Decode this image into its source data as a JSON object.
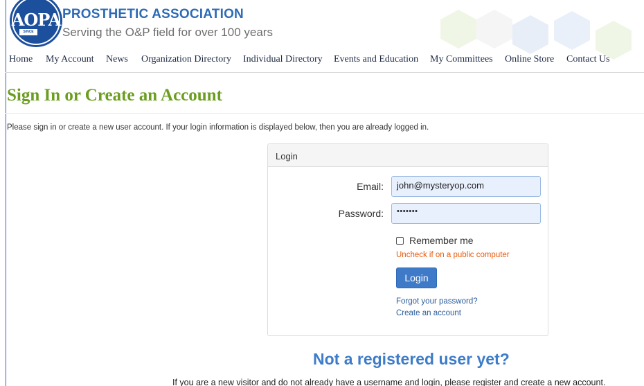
{
  "header": {
    "org_name": "PROSTHETIC ASSOCIATION",
    "tagline": "Serving the O&P field for over 100 years",
    "logo_letters": "AOPA",
    "logo_badge": "SINCE 1917"
  },
  "nav": {
    "items": [
      {
        "label": "Home"
      },
      {
        "label": "My Account"
      },
      {
        "label": "News"
      },
      {
        "label": "Organization Directory"
      },
      {
        "label": "Individual Directory"
      },
      {
        "label": "Events and Education"
      },
      {
        "label": "My Committees"
      },
      {
        "label": "Online Store"
      },
      {
        "label": "Contact Us"
      }
    ]
  },
  "page": {
    "title": "Sign In or Create an Account",
    "intro": "Please sign in or create a new user account. If your login information is displayed below, then you are already logged in."
  },
  "login_panel": {
    "heading": "Login",
    "email_label": "Email:",
    "email_value": "john@mysteryop.com",
    "password_label": "Password:",
    "password_value": "•••••••",
    "remember_label": "Remember me",
    "remember_checked": false,
    "remember_hint": "Uncheck if on a public computer",
    "login_button": "Login",
    "forgot_link": "Forgot your password?",
    "create_link": "Create an account"
  },
  "register": {
    "heading": "Not a registered user yet?",
    "text": "If you are a new visitor and do not already have a username and login, please register and create a new account."
  },
  "colors": {
    "brand_blue": "#2d6bb5",
    "title_green": "#6b9e1f",
    "hint_orange": "#e8590c",
    "button_blue": "#3f7ac9"
  }
}
